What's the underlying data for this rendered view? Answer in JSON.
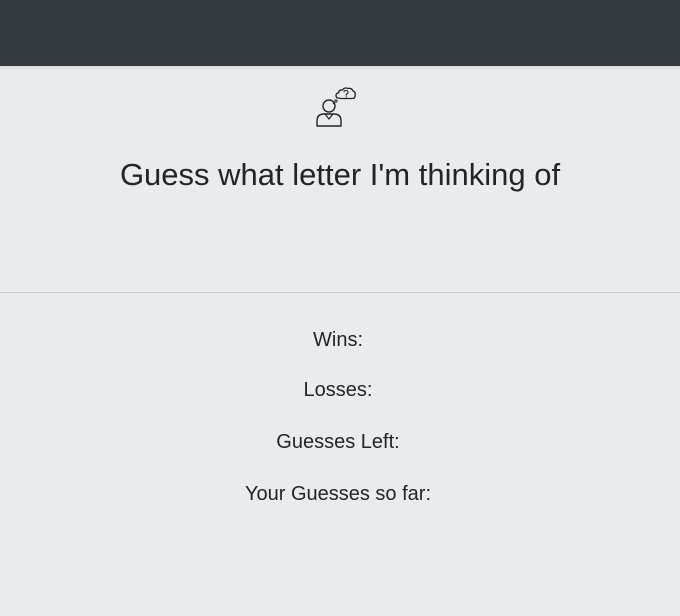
{
  "navbar": {},
  "hero": {
    "icon": "person-thinking-question-icon",
    "title": "Guess what letter I'm thinking of"
  },
  "stats": {
    "wins_label": "Wins:",
    "wins_value": "",
    "losses_label": "Losses:",
    "losses_value": "",
    "guesses_left_label": "Guesses Left:",
    "guesses_left_value": "",
    "guesses_so_far_label": "Your Guesses so far:",
    "guesses_so_far_value": ""
  },
  "colors": {
    "navbar": "#343a40",
    "background": "#e9ecef",
    "text": "#212529"
  }
}
